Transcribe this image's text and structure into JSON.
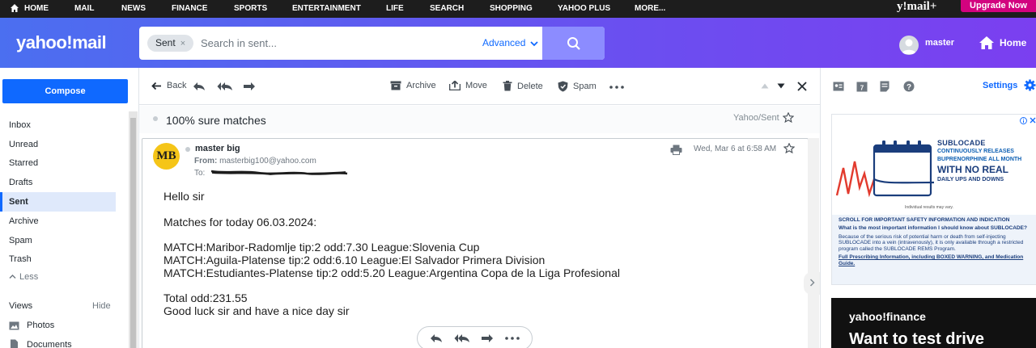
{
  "top_nav": {
    "items": [
      "HOME",
      "MAIL",
      "NEWS",
      "FINANCE",
      "SPORTS",
      "ENTERTAINMENT",
      "LIFE",
      "SEARCH",
      "SHOPPING",
      "YAHOO PLUS",
      "MORE..."
    ],
    "brand": "y!mail+",
    "upgrade": "Upgrade Now"
  },
  "header": {
    "logo": "yahoo!mail",
    "search": {
      "chip": "Sent",
      "chip_close": "×",
      "placeholder": "Search in sent...",
      "advanced": "Advanced"
    },
    "user": "master",
    "home": "Home"
  },
  "sidebar": {
    "compose": "Compose",
    "folders": [
      "Inbox",
      "Unread",
      "Starred",
      "Drafts",
      "Sent",
      "Archive",
      "Spam",
      "Trash"
    ],
    "active_folder": "Sent",
    "less": "Less",
    "views": "Views",
    "hide": "Hide",
    "view_items": [
      "Photos",
      "Documents"
    ]
  },
  "toolbar": {
    "back": "Back",
    "archive": "Archive",
    "move": "Move",
    "delete": "Delete",
    "spam": "Spam"
  },
  "message": {
    "subject": "100% sure matches",
    "folder_tag": "Yahoo/Sent",
    "avatar_initials": "MB",
    "sender": "master big",
    "from_label": "From:",
    "from_email": "masterbig100@yahoo.com",
    "to_label": "To:",
    "date": "Wed, Mar 6 at 6:58 AM",
    "body": [
      "Hello sir",
      "Matches for today 06.03.2024:",
      "MATCH:Maribor-Radomlje tip:2 odd:7.30 League:Slovenia Cup",
      "MATCH:Aguila-Platense tip:2 odd:6.10 League:El Salvador Primera Division",
      "MATCH:Estudiantes-Platense tip:2 odd:5.20 League:Argentina Copa de la Liga Profesional",
      "Total odd:231.55",
      "Good luck sir and have a nice day sir"
    ]
  },
  "right_rail": {
    "settings": "Settings",
    "ad1": {
      "brand": "SUBLOCADE",
      "line1": "CONTINUOUSLY RELEASES",
      "line2": "BUPRENORPHINE ALL MONTH",
      "big": "WITH NO REAL",
      "daily": "DAILY UPS AND DOWNS",
      "note": "Individual results may vary.",
      "scroll_header": "SCROLL FOR IMPORTANT SAFETY INFORMATION AND INDICATION",
      "question": "What is the most important information I should know about SUBLOCADE?",
      "para": "Because of the serious risk of potential harm or death from self-injecting SUBLOCADE into a vein (intravenously), it is only available through a restricted program called the SUBLOCADE REMS Program.",
      "full_pi": "Full Prescribing Information, including BOXED WARNING, and Medication Guide."
    },
    "ad2": {
      "logo": "yahoo!finance",
      "title": "Want to test drive"
    }
  },
  "colors": {
    "accent": "#0f69ff",
    "header_start": "#4b6ff0",
    "header_end": "#7b3ff0",
    "upgrade": "#d2037f"
  }
}
